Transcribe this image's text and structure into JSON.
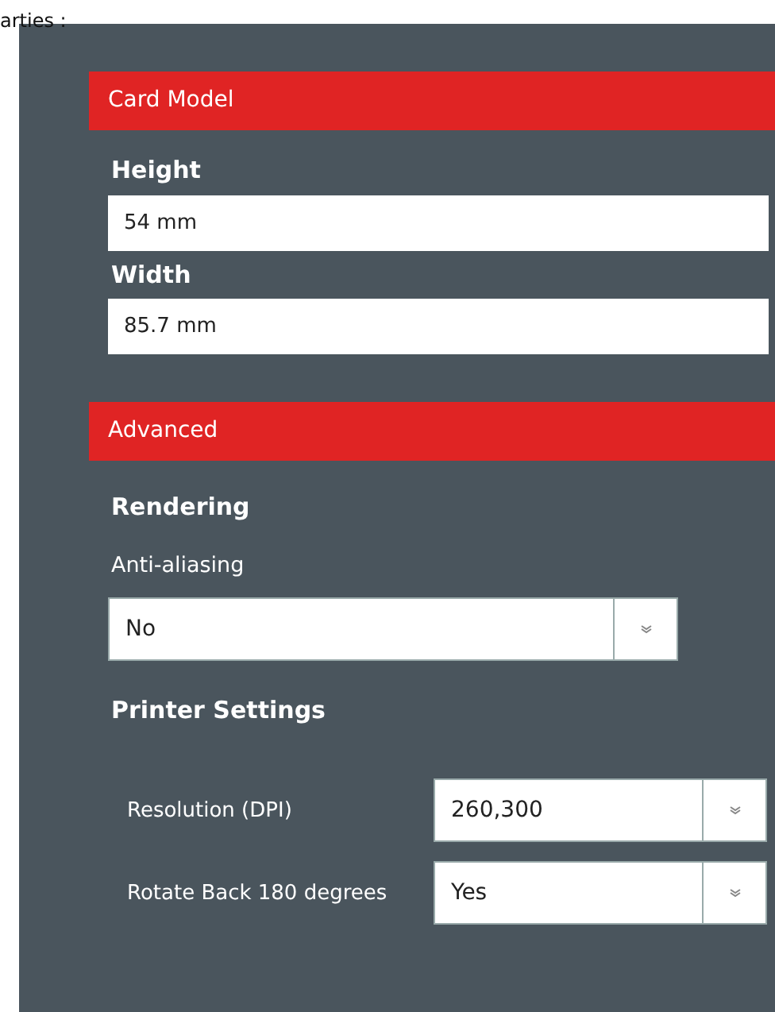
{
  "page_title": "arties :",
  "sections": [
    {
      "title": "Card Model",
      "items": [
        {
          "kind": "field",
          "label": "Height",
          "value": "54 mm"
        },
        {
          "kind": "field",
          "label": "Width",
          "value": "85.7 mm"
        }
      ]
    },
    {
      "title": "Advanced",
      "items": [
        {
          "kind": "subheading",
          "text": "Rendering"
        },
        {
          "kind": "label",
          "text": "Anti-aliasing"
        },
        {
          "kind": "select",
          "value": "No"
        },
        {
          "kind": "subheading",
          "text": "Printer Settings"
        },
        {
          "kind": "select_row",
          "label": "Resolution (DPI)",
          "value": "260,300"
        },
        {
          "kind": "select_row",
          "label": "Rotate Back 180 degrees",
          "value": "Yes"
        }
      ]
    }
  ]
}
